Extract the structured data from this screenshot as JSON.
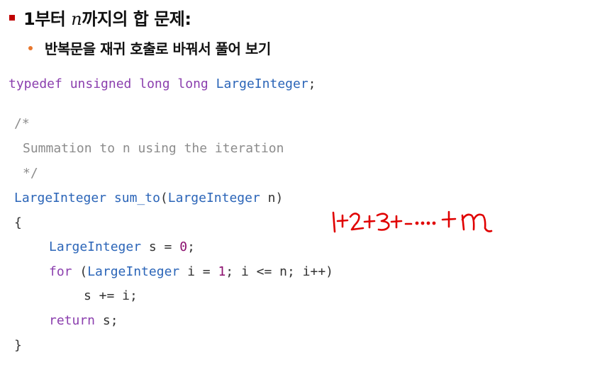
{
  "header": {
    "title_prefix": "1부터 ",
    "title_math": "n",
    "title_suffix": "까지의 합 문제:",
    "subtitle": "반복문을 재귀 호출로 바꿔서 풀어 보기"
  },
  "code": {
    "typedef": {
      "keyword": "typedef",
      "type": "unsigned long long",
      "name": "LargeInteger",
      "end": ";"
    },
    "comment_open": "/*",
    "comment_text": "Summation to n using the iteration",
    "comment_close": "*/",
    "signature": {
      "return_type": "LargeInteger",
      "func": "sum_to",
      "paren_open": "(",
      "param_type": "LargeInteger",
      "param_name": " n",
      "paren_close": ")"
    },
    "brace_open": "{",
    "decl": {
      "type": "LargeInteger",
      "rest": " s = ",
      "value": "0",
      "end": ";"
    },
    "for_line": {
      "keyword": "for",
      "open": " (",
      "type": "LargeInteger",
      "init": " i = ",
      "init_value": "1",
      "cond": "; i <= n; i++)"
    },
    "body_line": "s += i;",
    "return_line": {
      "keyword": "return",
      "rest": " s;"
    },
    "brace_close": "}"
  },
  "annotation": {
    "handwritten_note": "1+2+3+····+n",
    "ink_color": "#e00000"
  },
  "colors": {
    "keyword": "#8b3fae",
    "type": "#2b65b8",
    "comment": "#8c8c8c",
    "number": "#8b0f6e",
    "bullet_red": "#c00000",
    "bullet_orange": "#e8772e"
  }
}
